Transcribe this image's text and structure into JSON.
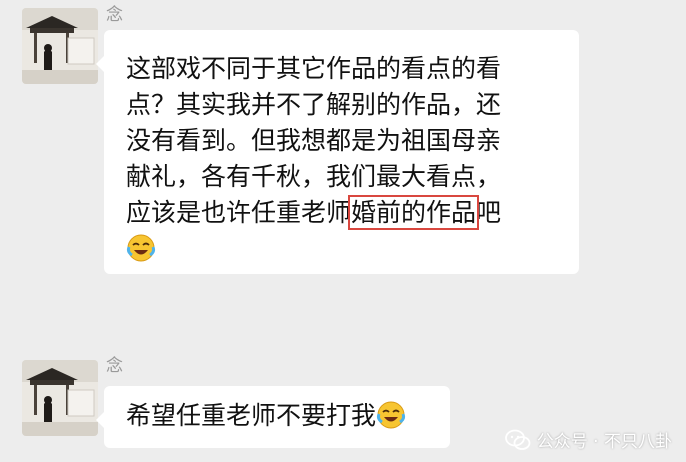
{
  "messages": [
    {
      "sender": "念",
      "lines": [
        "这部戏不同于其它作品的看点的看",
        "点？其实我并不了解别的作品，还",
        "没有看到。但我想都是为祖国母亲",
        "献礼，各有千秋，我们最大看点，"
      ],
      "last_line_prefix": "应该是也许任重老师",
      "highlighted": "婚前的作品",
      "last_line_suffix": "吧",
      "trailing_emoji": "laughing-crying-emoji"
    },
    {
      "sender": "念",
      "text": "希望任重老师不要打我",
      "trailing_emoji": "laughing-crying-emoji"
    }
  ],
  "watermark": {
    "text": "公众号 · 不只八卦",
    "icon": "wechat-official-account-icon"
  },
  "colors": {
    "background": "#ededed",
    "bubble": "#ffffff",
    "highlight_box": "#d9473f"
  }
}
